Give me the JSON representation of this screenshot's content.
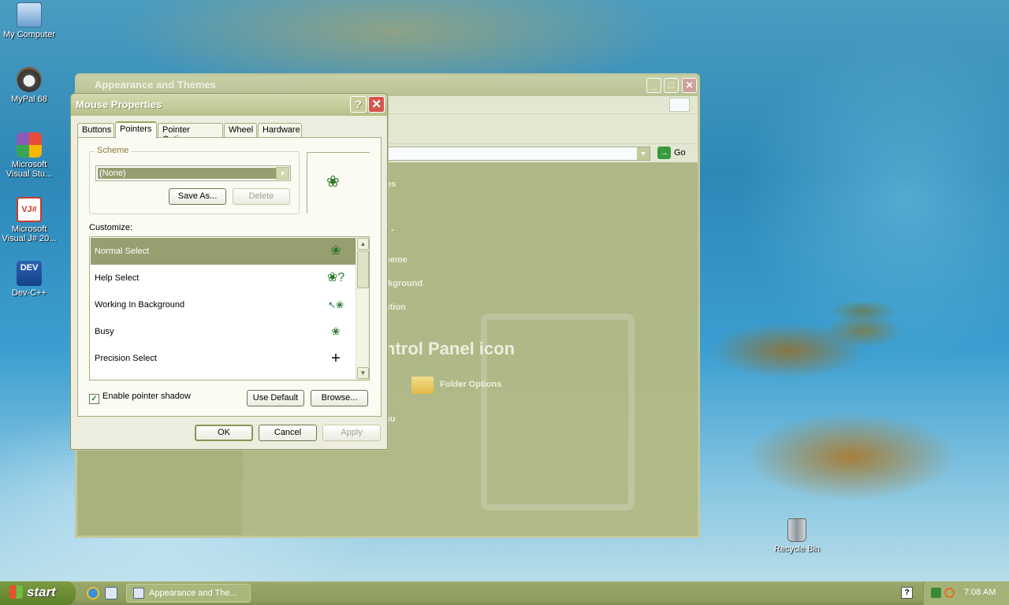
{
  "desktop": {
    "icons": [
      {
        "label": "My Computer"
      },
      {
        "label": "MyPal 68"
      },
      {
        "label": "Microsoft Visual Stu..."
      },
      {
        "label": "Microsoft Visual J# 20..."
      },
      {
        "label": "Dev-C++"
      },
      {
        "label": "Recycle Bin"
      }
    ]
  },
  "bg_window": {
    "title": "Appearance and Themes",
    "address_go": "Go",
    "fragments": {
      "tasks": "es",
      "dash": "-",
      "theme": "heme",
      "background": "ckground",
      "resolution": "ution",
      "cp_icon": "ntrol Panel icon",
      "folder_options": "Folder Options",
      "menu": "nu"
    }
  },
  "dialog": {
    "title": "Mouse Properties",
    "help_glyph": "?",
    "close_glyph": "✕",
    "tabs": [
      "Buttons",
      "Pointers",
      "Pointer Options",
      "Wheel",
      "Hardware"
    ],
    "active_tab": "Pointers",
    "scheme": {
      "legend": "Scheme",
      "selected": "(None)",
      "save_as": "Save As...",
      "delete": "Delete"
    },
    "customize_label": "Customize:",
    "pointer_list": [
      {
        "label": "Normal Select",
        "selected": true
      },
      {
        "label": "Help Select",
        "selected": false
      },
      {
        "label": "Working In Background",
        "selected": false
      },
      {
        "label": "Busy",
        "selected": false
      },
      {
        "label": "Precision Select",
        "selected": false
      }
    ],
    "enable_shadow": {
      "label": "Enable pointer shadow",
      "checked": true
    },
    "use_default": "Use Default",
    "browse": "Browse...",
    "ok": "OK",
    "cancel": "Cancel",
    "apply": "Apply"
  },
  "taskbar": {
    "start": "start",
    "task": "Appearance and The...",
    "time": "7:08 AM"
  }
}
